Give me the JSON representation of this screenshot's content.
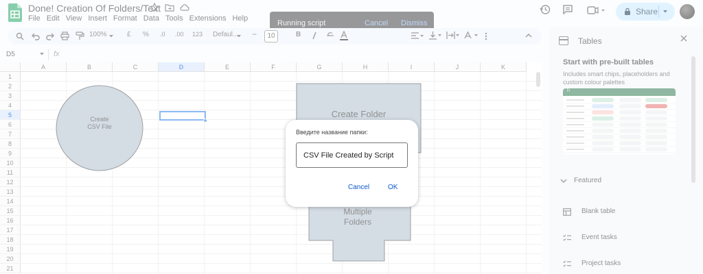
{
  "header": {
    "title": "Done! Creation Of Folders/Text",
    "menu": [
      "File",
      "Edit",
      "View",
      "Insert",
      "Format",
      "Data",
      "Tools",
      "Extensions",
      "Help"
    ],
    "share_label": "Share"
  },
  "snackbar": {
    "message": "Running script",
    "cancel": "Cancel",
    "dismiss": "Dismiss"
  },
  "toolbar": {
    "zoom": "100%",
    "currency": "£",
    "percent": "%",
    "dec_decrease": ".0",
    "dec_increase": ".00",
    "number_format": "123",
    "font": "Defaul...",
    "font_size": "10",
    "bold": "B"
  },
  "formula_bar": {
    "name_box": "D5",
    "fx": "fx"
  },
  "grid": {
    "columns": [
      "A",
      "B",
      "C",
      "D",
      "E",
      "F",
      "G",
      "H",
      "I",
      "J",
      "K"
    ],
    "rows": [
      "1",
      "2",
      "3",
      "4",
      "5",
      "6",
      "7",
      "8",
      "9",
      "10",
      "11",
      "12",
      "13",
      "14",
      "15",
      "16",
      "17",
      "18",
      "19",
      "20",
      "21"
    ],
    "selected_column": "D",
    "selected_row": "5"
  },
  "shapes": {
    "circle_text": "Create\nCSV File",
    "folder_text": "Create Folder",
    "multiple_text": "Multiple\nFolders"
  },
  "panel": {
    "title": "Tables",
    "heading": "Start with pre-built tables",
    "subtext": "Includes smart chips, placeholders and custom colour palettes",
    "thumb_header": "Tr",
    "featured": "Featured",
    "items": [
      "Blank table",
      "Event tasks",
      "Project tasks"
    ]
  },
  "dialog": {
    "prompt": "Введите название папки:",
    "input_value": "CSV File Created by Script",
    "cancel": "Cancel",
    "ok": "OK"
  },
  "colors": {
    "accent": "#1a73e8",
    "share_bg": "#c2e7ff",
    "shape_fill": "#a9b9c9",
    "snackbar_bg": "#303134"
  }
}
